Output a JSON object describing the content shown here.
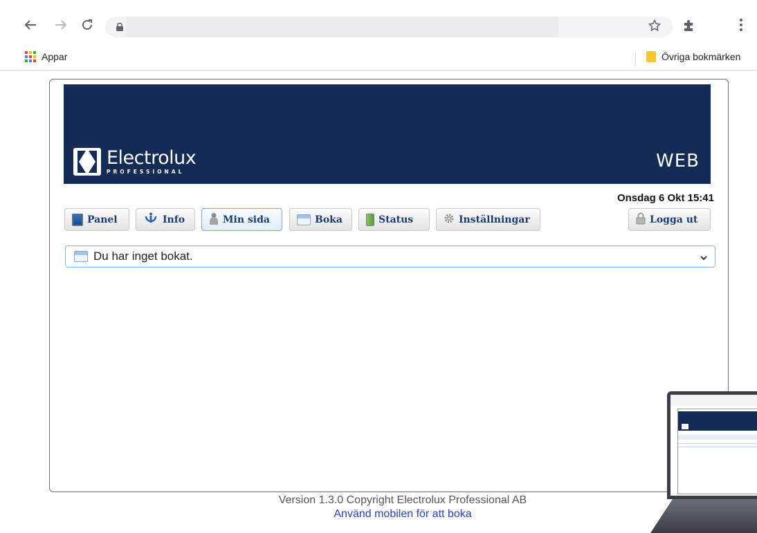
{
  "browser": {
    "bookmarks": {
      "apps_label": "Appar",
      "other_label": "Övriga bokmärken"
    }
  },
  "banner": {
    "brand": "Electrolux",
    "brand_sub": "PROFESSIONAL",
    "app_label": "WEB"
  },
  "datetime": "Onsdag 6 Okt 15:41",
  "nav": {
    "panel": "Panel",
    "info": "Info",
    "min_sida": "Min sida",
    "boka": "Boka",
    "status": "Status",
    "installningar": "Inställningar",
    "logout": "Logga ut",
    "active": "Min sida"
  },
  "bookings_select": {
    "value": "Du har inget bokat."
  },
  "footer": {
    "version": "Version 1.3.0 Copyright Electrolux Professional AB",
    "mobile_link": "Använd mobilen för att boka"
  },
  "colors": {
    "banner": "#142b55",
    "nav_text": "#1a3a78",
    "link": "#2440d8"
  }
}
